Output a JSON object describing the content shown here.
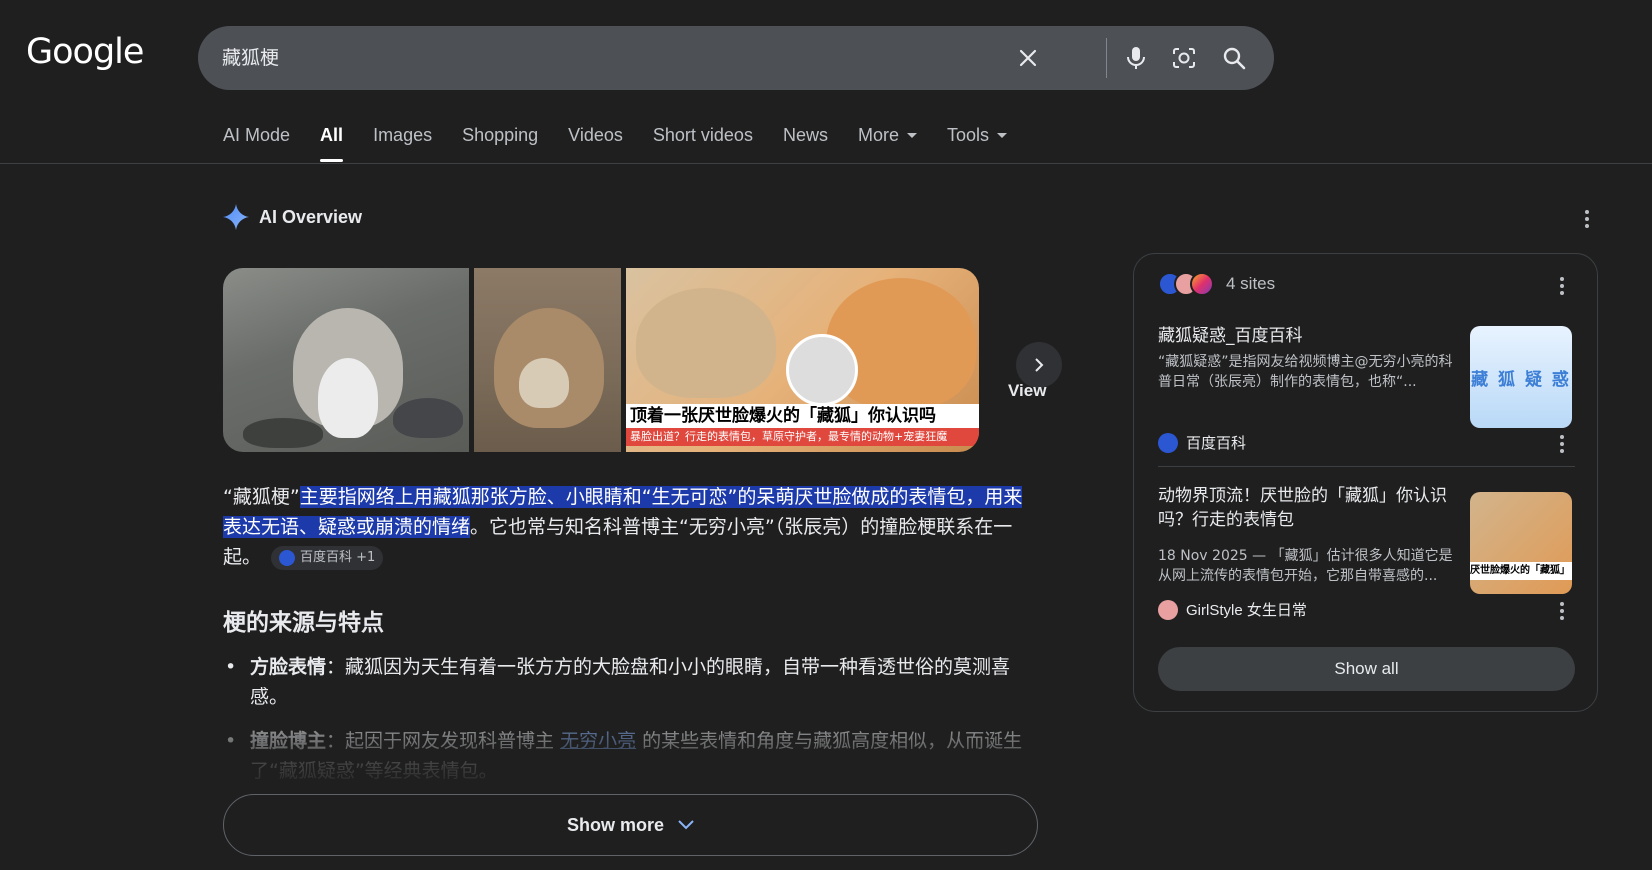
{
  "header": {
    "logo": "Google",
    "search_value": "藏狐梗"
  },
  "tabs": [
    {
      "label": "AI Mode"
    },
    {
      "label": "All"
    },
    {
      "label": "Images"
    },
    {
      "label": "Shopping"
    },
    {
      "label": "Videos"
    },
    {
      "label": "Short videos"
    },
    {
      "label": "News"
    },
    {
      "label": "More"
    },
    {
      "label": "Tools"
    }
  ],
  "ai_overview": {
    "title": "AI Overview",
    "images": {
      "image3_caption": "顶着一张厌世脸爆火的「藏狐」你认识吗",
      "image3_subcaption": "暴脸出道？行走的表情包，草原守护者，最专情的动物+宠妻狂魔",
      "view_label": "View"
    },
    "paragraph": {
      "prefix": "“藏狐梗”",
      "highlight": "主要指网络上用藏狐那张方脸、小眼睛和“生无可恋”的呆萌厌世脸做成的表情包，用来表达无语、疑惑或崩溃的情绪",
      "suffix": "。它也常与知名科普博主“无穷小亮”（张辰亮）的撞脸梗联系在一起。",
      "source_chip": "百度百科 +1"
    },
    "heading": "梗的来源与特点",
    "bullets": [
      {
        "term": "方脸表情",
        "text": "：藏狐因为天生有着一张方方的大脸盘和小小的眼睛，自带一种看透世俗的莫测喜感。"
      },
      {
        "term": "撞脸博主",
        "text_before": "：起因于网友发现科普博主 ",
        "link": "无穷小亮",
        "text_after": " 的某些表情和角度与藏狐高度相似，从而诞生了“藏狐疑惑”等经典表情包。"
      }
    ],
    "show_more": "Show more"
  },
  "sources_panel": {
    "count_label": "4 sites",
    "cards": [
      {
        "title": "藏狐疑惑_百度百科",
        "snippet": "“藏狐疑惑”是指网友给视频博主@无穷小亮的科普日常（张辰亮）制作的表情包，也称“...",
        "thumb_text": "藏 狐 疑 惑",
        "source": "百度百科"
      },
      {
        "title": "动物界顶流！厌世脸的「藏狐」你认识吗？行走的表情包",
        "snippet": "18 Nov 2025 — 「藏狐」估计很多人知道它是从网上流传的表情包开始，它那自带喜感的...",
        "thumb_text": "厌世脸爆火的「藏狐」",
        "source": "GirlStyle 女生日常"
      }
    ],
    "show_all": "Show all"
  },
  "colors": {
    "background": "#1f1f1f",
    "search_bar": "#4d5156",
    "highlight": "#1c3aa9",
    "link": "#8ab4f8",
    "gemini_blue": "#4f8cf7"
  }
}
